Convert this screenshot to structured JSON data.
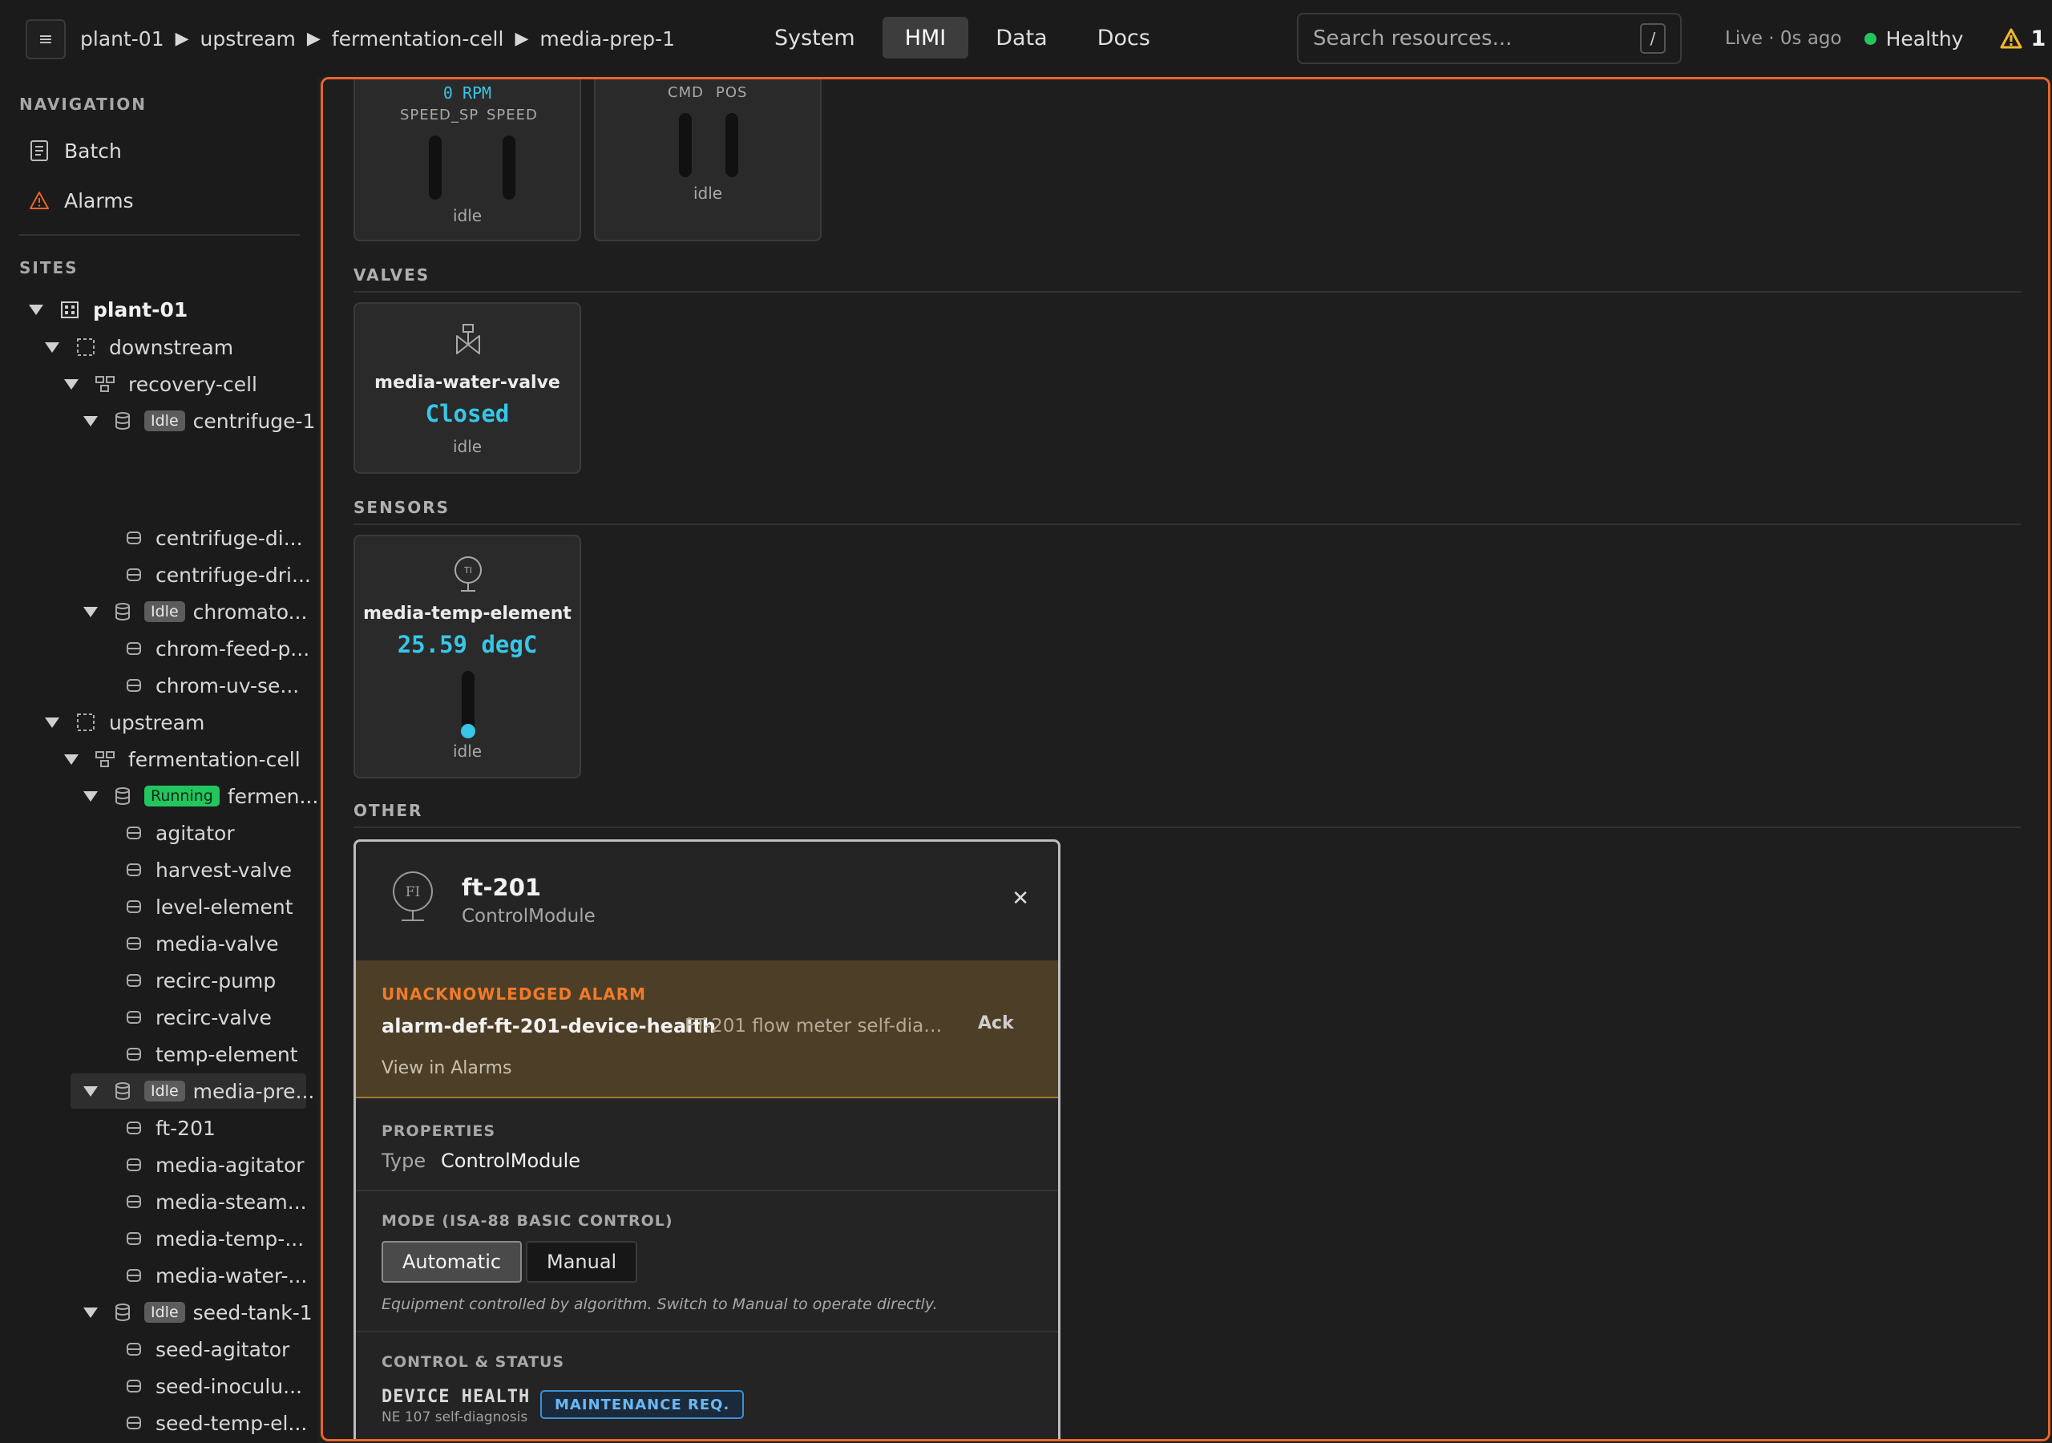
{
  "topbar": {
    "menu_glyph": "≡",
    "breadcrumb": [
      "plant-01",
      "upstream",
      "fermentation-cell",
      "media-prep-1"
    ],
    "breadcrumb_sep": "▶",
    "tabs": [
      {
        "label": "System",
        "active": false
      },
      {
        "label": "HMI",
        "active": true
      },
      {
        "label": "Data",
        "active": false
      },
      {
        "label": "Docs",
        "active": false
      }
    ],
    "search_placeholder": "Search resources...",
    "search_shortcut": "/",
    "live_status": "Live · 0s ago",
    "health_label": "Healthy",
    "health_color": "#22c55e",
    "alarm_count": "1",
    "alarm_icon": "warning-triangle-icon"
  },
  "sidebar": {
    "navigation_heading": "NAVIGATION",
    "nav_items": [
      {
        "label": "Batch",
        "icon": "document-icon"
      },
      {
        "label": "Alarms",
        "icon": "warning-icon"
      }
    ],
    "sites_heading": "SITES",
    "tree": [
      {
        "label": "plant-01",
        "level": 0,
        "caret": true,
        "icon": "building-icon",
        "badge": ""
      },
      {
        "label": "downstream",
        "level": 1,
        "caret": true,
        "icon": "area-icon",
        "badge": ""
      },
      {
        "label": "recovery-cell",
        "level": 2,
        "caret": true,
        "icon": "cell-icon",
        "badge": ""
      },
      {
        "label": "centrifuge-1",
        "level": 3,
        "caret": true,
        "icon": "unit-icon",
        "badge": "Idle"
      },
      {
        "label": "centrifuge-di...",
        "level": 4,
        "caret": false,
        "icon": "module-icon",
        "badge": ""
      },
      {
        "label": "centrifuge-dri...",
        "level": 4,
        "caret": false,
        "icon": "module-icon",
        "badge": ""
      },
      {
        "label": "chromato...",
        "level": 3,
        "caret": true,
        "icon": "unit-icon",
        "badge": "Idle"
      },
      {
        "label": "chrom-feed-p...",
        "level": 4,
        "caret": false,
        "icon": "module-icon",
        "badge": ""
      },
      {
        "label": "chrom-uv-se...",
        "level": 4,
        "caret": false,
        "icon": "module-icon",
        "badge": ""
      },
      {
        "label": "upstream",
        "level": 1,
        "caret": true,
        "icon": "area-icon",
        "badge": ""
      },
      {
        "label": "fermentation-cell",
        "level": 2,
        "caret": true,
        "icon": "cell-icon",
        "badge": ""
      },
      {
        "label": "fermen...",
        "level": 3,
        "caret": true,
        "icon": "unit-icon",
        "badge": "Running"
      },
      {
        "label": "agitator",
        "level": 4,
        "caret": false,
        "icon": "module-icon",
        "badge": ""
      },
      {
        "label": "harvest-valve",
        "level": 4,
        "caret": false,
        "icon": "module-icon",
        "badge": ""
      },
      {
        "label": "level-element",
        "level": 4,
        "caret": false,
        "icon": "module-icon",
        "badge": ""
      },
      {
        "label": "media-valve",
        "level": 4,
        "caret": false,
        "icon": "module-icon",
        "badge": ""
      },
      {
        "label": "recirc-pump",
        "level": 4,
        "caret": false,
        "icon": "module-icon",
        "badge": ""
      },
      {
        "label": "recirc-valve",
        "level": 4,
        "caret": false,
        "icon": "module-icon",
        "badge": ""
      },
      {
        "label": "temp-element",
        "level": 4,
        "caret": false,
        "icon": "module-icon",
        "badge": ""
      },
      {
        "label": "media-pre...",
        "level": 3,
        "caret": true,
        "icon": "unit-icon",
        "badge": "Idle",
        "selected": true
      },
      {
        "label": "ft-201",
        "level": 4,
        "caret": false,
        "icon": "module-icon",
        "badge": ""
      },
      {
        "label": "media-agitator",
        "level": 4,
        "caret": false,
        "icon": "module-icon",
        "badge": ""
      },
      {
        "label": "media-steam...",
        "level": 4,
        "caret": false,
        "icon": "module-icon",
        "badge": ""
      },
      {
        "label": "media-temp-...",
        "level": 4,
        "caret": false,
        "icon": "module-icon",
        "badge": ""
      },
      {
        "label": "media-water-...",
        "level": 4,
        "caret": false,
        "icon": "module-icon",
        "badge": ""
      },
      {
        "label": "seed-tank-1",
        "level": 3,
        "caret": true,
        "icon": "unit-icon",
        "badge": "Idle"
      },
      {
        "label": "seed-agitator",
        "level": 4,
        "caret": false,
        "icon": "module-icon",
        "badge": ""
      },
      {
        "label": "seed-inoculu...",
        "level": 4,
        "caret": false,
        "icon": "module-icon",
        "badge": ""
      },
      {
        "label": "seed-temp-el...",
        "level": 4,
        "caret": false,
        "icon": "module-icon",
        "badge": ""
      }
    ]
  },
  "main": {
    "top_cards": [
      {
        "rpm": "0 RPM",
        "labels": [
          "SPEED_SP",
          "SPEED"
        ],
        "status": "idle"
      },
      {
        "labels": [
          "CMD",
          "POS"
        ],
        "status": "idle"
      }
    ],
    "valves_heading": "VALVES",
    "valve_card": {
      "name": "media-water-valve",
      "value": "Closed",
      "status": "idle",
      "icon": "valve-icon"
    },
    "sensors_heading": "SENSORS",
    "sensor_card": {
      "name": "media-temp-element",
      "value": "25.59 degC",
      "status": "idle",
      "icon_text": "TI"
    },
    "other_heading": "OTHER",
    "accent_color": "#38c6e8",
    "frame_color": "#e8642a"
  },
  "panel": {
    "icon_text": "FI",
    "title": "ft-201",
    "subtitle": "ControlModule",
    "close_glyph": "✕",
    "alarm": {
      "heading": "UNACKNOWLEDGED ALARM",
      "id": "alarm-def-ft-201-device-health",
      "description": "FT-201 flow meter self-diag...",
      "ack_label": "Ack",
      "link_label": "View in Alarms"
    },
    "properties_heading": "PROPERTIES",
    "type_key": "Type",
    "type_value": "ControlModule",
    "mode_heading": "MODE (ISA-88 BASIC CONTROL)",
    "mode_options": [
      {
        "label": "Automatic",
        "selected": true
      },
      {
        "label": "Manual",
        "selected": false
      }
    ],
    "mode_note": "Equipment controlled by algorithm. Switch to Manual to operate directly.",
    "control_heading": "CONTROL & STATUS",
    "device_health_label": "DEVICE HEALTH",
    "device_health_sub": "NE 107 self-diagnosis",
    "device_health_badge": "MAINTENANCE REQ."
  }
}
